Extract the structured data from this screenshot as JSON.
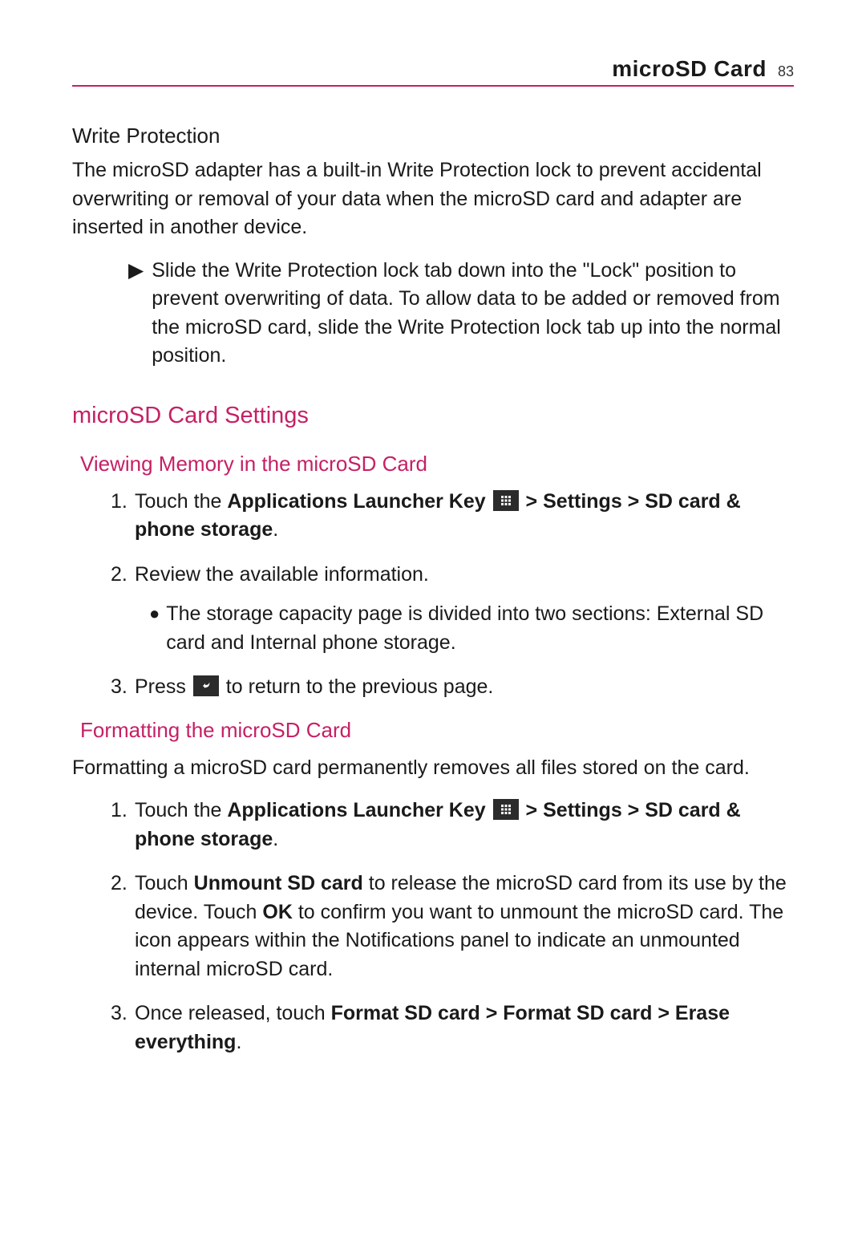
{
  "header": {
    "title": "microSD Card",
    "page": "83"
  },
  "s1": {
    "heading": "Write Protection",
    "para": "The microSD adapter has a built-in Write Protection lock to prevent accidental overwriting or removal of your data when the microSD card and adapter are inserted in another device.",
    "bullet_mark": "▶",
    "bullet": "Slide the Write Protection lock tab down into the \"Lock\" position to prevent overwriting of data. To allow data to be added or removed from the microSD card, slide the Write Protection lock tab up into the normal position."
  },
  "s2": {
    "heading": "microSD Card Settings",
    "sub_a": "Viewing Memory in the microSD Card",
    "a1_pre": "Touch the ",
    "a1_bold": "Applications Launcher Key",
    "a1_gt": " > ",
    "a1_settings": "Settings > SD card & phone storage",
    "a1_dot": ".",
    "a2": "Review the available information.",
    "a2_inner": "The storage capacity page is divided into two sections: External SD card and Internal phone storage.",
    "a3_pre": "Press ",
    "a3_post": " to return to the previous page."
  },
  "s3": {
    "sub": "Formatting the microSD Card",
    "para": "Formatting a microSD card permanently removes all files stored on the card.",
    "b1_pre": "Touch the ",
    "b1_bold": "Applications Launcher Key",
    "b1_gt": " > ",
    "b1_settings": "Settings > SD card & phone storage",
    "b1_dot": ".",
    "b2_pre": "Touch ",
    "b2_bold1": "Unmount SD card",
    "b2_mid1": " to release the microSD card from its use by the device. Touch ",
    "b2_bold2": "OK",
    "b2_post": " to confirm you want to unmount the microSD card. The icon appears within the Notifications panel to indicate an unmounted internal microSD card.",
    "b3_pre": "Once released, touch ",
    "b3_bold": "Format SD card > Format SD card > Erase everything",
    "b3_dot": "."
  }
}
